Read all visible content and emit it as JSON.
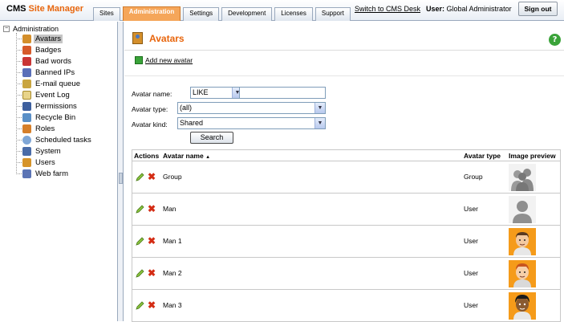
{
  "header": {
    "brand_cms": "CMS",
    "brand_site_manager": "Site Manager",
    "tabs": [
      {
        "label": "Sites"
      },
      {
        "label": "Administration"
      },
      {
        "label": "Settings"
      },
      {
        "label": "Development"
      },
      {
        "label": "Licenses"
      },
      {
        "label": "Support"
      }
    ],
    "switch_link": "Switch to CMS Desk",
    "user_label": "User:",
    "user_name": "Global Administrator",
    "signout_label": "Sign out"
  },
  "tree": {
    "root_label": "Administration",
    "items": [
      {
        "label": "Avatars",
        "icon": "avatar-icon"
      },
      {
        "label": "Badges",
        "icon": "badge-icon"
      },
      {
        "label": "Bad words",
        "icon": "bad-words-icon"
      },
      {
        "label": "Banned IPs",
        "icon": "banned-ip-icon"
      },
      {
        "label": "E-mail queue",
        "icon": "email-queue-icon"
      },
      {
        "label": "Event Log",
        "icon": "event-log-icon"
      },
      {
        "label": "Permissions",
        "icon": "permissions-icon"
      },
      {
        "label": "Recycle Bin",
        "icon": "recycle-bin-icon"
      },
      {
        "label": "Roles",
        "icon": "roles-icon"
      },
      {
        "label": "Scheduled tasks",
        "icon": "clock-icon"
      },
      {
        "label": "System",
        "icon": "system-icon"
      },
      {
        "label": "Users",
        "icon": "users-icon"
      },
      {
        "label": "Web farm",
        "icon": "web-farm-icon"
      }
    ]
  },
  "main": {
    "title": "Avatars",
    "help_label": "?",
    "add_new_label": "Add new avatar",
    "filters": {
      "name_label": "Avatar name:",
      "name_operator": "LIKE",
      "name_value": "",
      "type_label": "Avatar type:",
      "type_value": "(all)",
      "kind_label": "Avatar kind:",
      "kind_value": "Shared",
      "search_label": "Search"
    },
    "table": {
      "headers": {
        "actions": "Actions",
        "name": "Avatar name",
        "type": "Avatar type",
        "preview": "Image preview"
      },
      "rows": [
        {
          "name": "Group",
          "type": "Group"
        },
        {
          "name": "Man",
          "type": "User"
        },
        {
          "name": "Man 1",
          "type": "User"
        },
        {
          "name": "Man 2",
          "type": "User"
        },
        {
          "name": "Man 3",
          "type": "User"
        }
      ]
    }
  }
}
